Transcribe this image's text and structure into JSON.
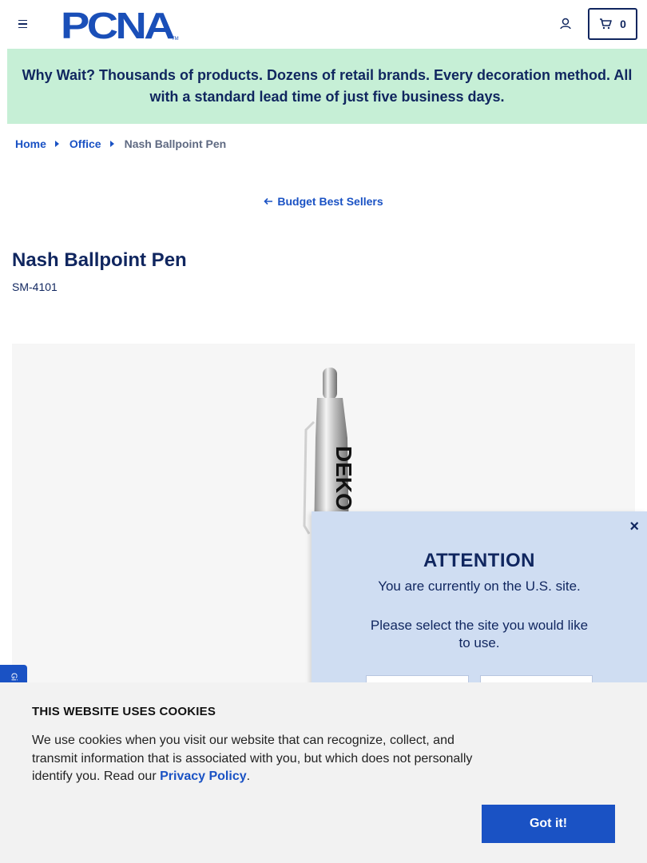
{
  "header": {
    "logo_text": "PCNA",
    "logo_tm": "TM",
    "cart_count": "0",
    "brand_color": "#10265f",
    "accent_color": "#1a52c4"
  },
  "promo": {
    "text": "Why Wait? Thousands of products. Dozens of retail brands. Every decoration method. All with a standard lead time of just five business days.",
    "background": "#c6efd6"
  },
  "breadcrumb": {
    "items": [
      "Home",
      "Office"
    ],
    "current": "Nash Ballpoint Pen"
  },
  "back_link": {
    "label": "Budget Best Sellers"
  },
  "product": {
    "title": "Nash Ballpoint Pen",
    "sku": "SM-4101",
    "imprint_text": "DEKO"
  },
  "side_tab": {
    "label": "Gi"
  },
  "attention_modal": {
    "close": "×",
    "title": "ATTENTION",
    "line1": "You are currently on the U.S. site.",
    "line2": "Please select the site you would like to use."
  },
  "cookie_banner": {
    "title": "THIS WEBSITE USES COOKIES",
    "text": "We use cookies when you visit our website that can recognize, collect, and transmit information that is associated with you, but which does not personally identify you. Read our ",
    "link": "Privacy Policy",
    "period": ".",
    "button": "Got it!"
  }
}
